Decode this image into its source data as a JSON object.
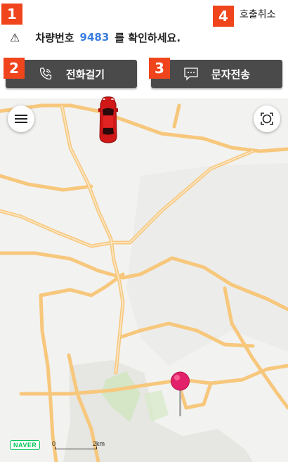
{
  "header": {
    "cancel_label": "호출취소",
    "notice_prefix": "차량번호",
    "plate_number": "9483",
    "notice_suffix": "를 확인하세요."
  },
  "actions": {
    "call_label": "전화걸기",
    "message_label": "문자전송"
  },
  "badges": [
    "1",
    "2",
    "3",
    "4"
  ],
  "map": {
    "provider_logo": "NAVER",
    "scale_zero": "0",
    "scale_distance": "2km"
  },
  "icons": {
    "warning": "warning-icon",
    "phone": "phone-icon",
    "message": "message-icon",
    "menu": "hamburger-menu-icon",
    "locate": "current-location-icon",
    "car": "car-icon",
    "pin": "destination-pin-icon"
  },
  "colors": {
    "badge": "#f0441c",
    "plate": "#3a7de0",
    "button_bg": "#4a4a4a",
    "road": "#f7c77c",
    "park": "#cfe6bf",
    "car": "#d01818",
    "pin": "#e3216a",
    "naver": "#03c75a"
  }
}
